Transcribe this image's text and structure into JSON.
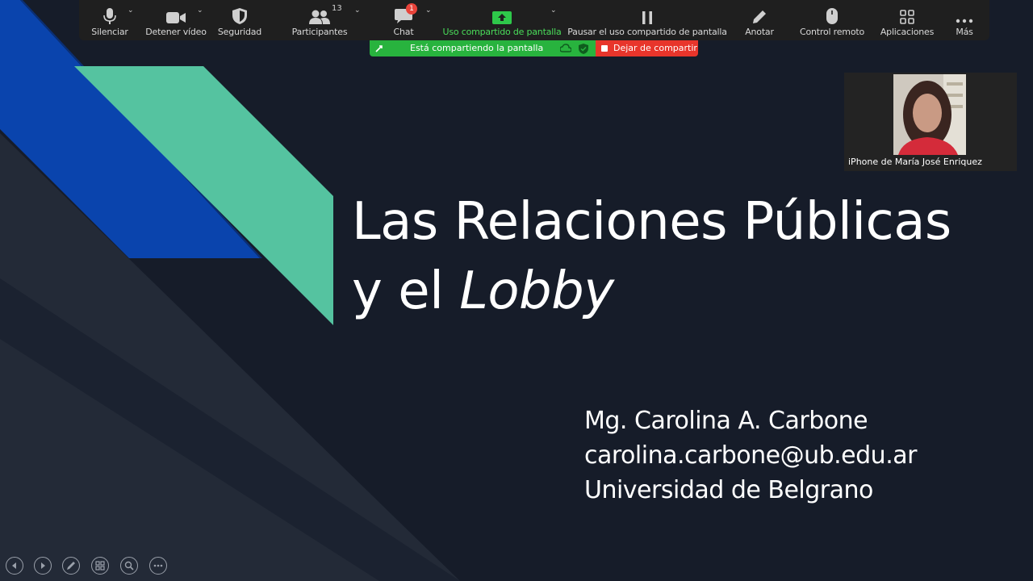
{
  "toolbar": {
    "mute_label": "Silenciar",
    "stop_video_label": "Detener vídeo",
    "security_label": "Seguridad",
    "participants_label": "Participantes",
    "participants_count": "13",
    "chat_label": "Chat",
    "chat_unread": "1",
    "share_label": "Uso compartido de pantalla",
    "pause_share_label": "Pausar el uso compartido de pantalla",
    "annotate_label": "Anotar",
    "remote_control_label": "Control remoto",
    "apps_label": "Aplicaciones",
    "more_label": "Más"
  },
  "share_status": {
    "banner_text": "Está compartiendo la pantalla",
    "stop_label": "Dejar de compartir"
  },
  "video": {
    "participant_name": "iPhone de María José Enriquez"
  },
  "slide": {
    "title_line1": "Las Relaciones Públicas",
    "title_line2_plain": "y el ",
    "title_line2_italic": "Lobby",
    "author_name": "Mg. Carolina A. Carbone",
    "author_email": "carolina.carbone@ub.edu.ar",
    "author_institution": "Universidad de Belgrano"
  },
  "slide_controls": [
    "previous-icon",
    "next-icon",
    "pen-icon",
    "slides-grid-icon",
    "zoom-icon",
    "more-icon"
  ],
  "colors": {
    "accent_green": "#4ade5a",
    "share_banner": "#28b33e",
    "stop_red": "#e8352b",
    "slide_blue": "#0a44ad",
    "slide_teal": "#55c3a0"
  }
}
